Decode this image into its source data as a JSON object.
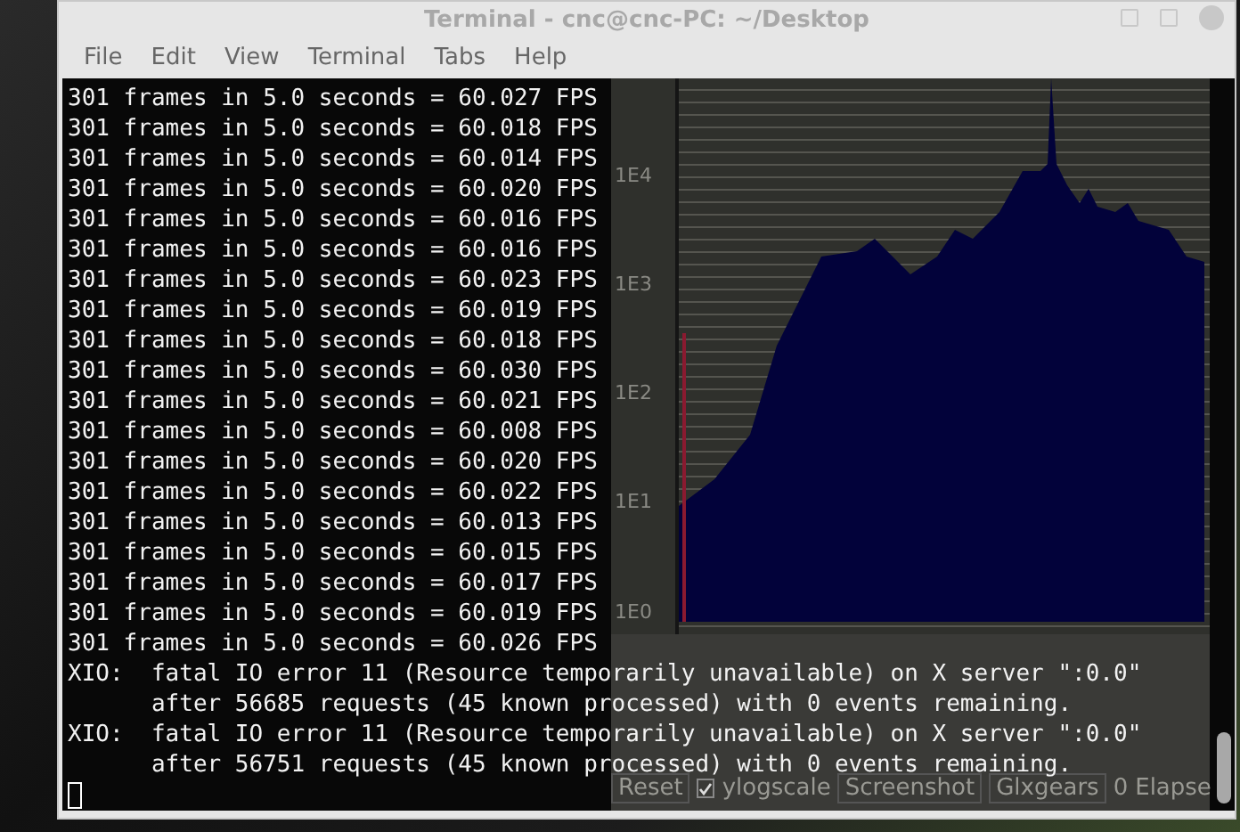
{
  "window": {
    "title": "Terminal - cnc@cnc-PC: ~/Desktop"
  },
  "menu": [
    "File",
    "Edit",
    "View",
    "Terminal",
    "Tabs",
    "Help"
  ],
  "output_lines": [
    "301 frames in 5.0 seconds = 60.027 FPS",
    "301 frames in 5.0 seconds = 60.018 FPS",
    "301 frames in 5.0 seconds = 60.014 FPS",
    "301 frames in 5.0 seconds = 60.020 FPS",
    "301 frames in 5.0 seconds = 60.016 FPS",
    "301 frames in 5.0 seconds = 60.016 FPS",
    "301 frames in 5.0 seconds = 60.023 FPS",
    "301 frames in 5.0 seconds = 60.019 FPS",
    "301 frames in 5.0 seconds = 60.018 FPS",
    "301 frames in 5.0 seconds = 60.030 FPS",
    "301 frames in 5.0 seconds = 60.021 FPS",
    "301 frames in 5.0 seconds = 60.008 FPS",
    "301 frames in 5.0 seconds = 60.020 FPS",
    "301 frames in 5.0 seconds = 60.022 FPS",
    "301 frames in 5.0 seconds = 60.013 FPS",
    "301 frames in 5.0 seconds = 60.015 FPS",
    "301 frames in 5.0 seconds = 60.017 FPS",
    "301 frames in 5.0 seconds = 60.019 FPS",
    "301 frames in 5.0 seconds = 60.026 FPS",
    "XIO:  fatal IO error 11 (Resource temporarily unavailable) on X server \":0.0\"",
    "      after 56685 requests (45 known processed) with 0 events remaining.",
    "XIO:  fatal IO error 11 (Resource temporarily unavailable) on X server \":0.0\"",
    "      after 56751 requests (45 known processed) with 0 events remaining."
  ],
  "background_app": {
    "y_ticks": [
      "1E4",
      "1E3",
      "1E2",
      "1E1",
      "1E0"
    ],
    "controls": [
      {
        "kind": "button",
        "label": "Reset"
      },
      {
        "kind": "checkbox",
        "label": "ylogscale",
        "checked": true
      },
      {
        "kind": "button",
        "label": "Screenshot"
      },
      {
        "kind": "button",
        "label": "Glxgears"
      },
      {
        "kind": "text",
        "label": "0"
      },
      {
        "kind": "text",
        "label": "Elapse"
      }
    ]
  }
}
